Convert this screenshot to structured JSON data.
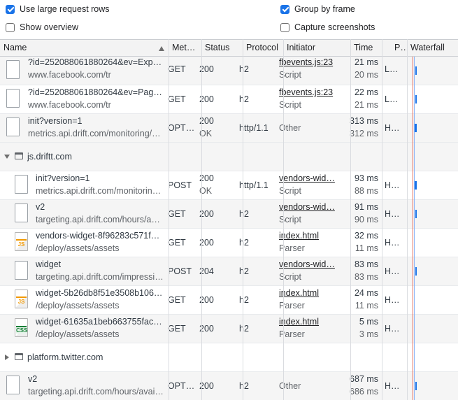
{
  "options": {
    "large_rows": {
      "label": "Use large request rows",
      "checked": true
    },
    "group_by_frame": {
      "label": "Group by frame",
      "checked": true
    },
    "show_overview": {
      "label": "Show overview",
      "checked": false
    },
    "capture_screenshots": {
      "label": "Capture screenshots",
      "checked": false
    }
  },
  "columns": {
    "name": "Name",
    "method": "Met…",
    "status": "Status",
    "protocol": "Protocol",
    "initiator": "Initiator",
    "time": "Time",
    "priority": "P…",
    "waterfall": "Waterfall"
  },
  "requests_top": [
    {
      "name": "?id=252088061880264&ev=Expe…",
      "path": "www.facebook.com/tr",
      "method": "GET",
      "status": "200",
      "status_text": "",
      "protocol": "h2",
      "initiator": "fbevents.js:23",
      "initiator_type": "Script",
      "time": "21 ms",
      "latency": "20 ms",
      "priority": "L…",
      "icon": "document-icon"
    },
    {
      "name": "?id=252088061880264&ev=Page…",
      "path": "www.facebook.com/tr",
      "method": "GET",
      "status": "200",
      "status_text": "",
      "protocol": "h2",
      "initiator": "fbevents.js:23",
      "initiator_type": "Script",
      "time": "22 ms",
      "latency": "21 ms",
      "priority": "L…",
      "icon": "document-icon"
    },
    {
      "name": "init?version=1",
      "path": "metrics.api.drift.com/monitoring/…",
      "method": "OPT…",
      "status": "200",
      "status_text": "OK",
      "protocol": "http/1.1",
      "initiator": "Other",
      "initiator_type": "",
      "time": "313 ms",
      "latency": "312 ms",
      "priority": "H…",
      "icon": "document-icon"
    }
  ],
  "group_drift": {
    "name": "js.driftt.com",
    "expanded": true
  },
  "requests_drift": [
    {
      "name": "init?version=1",
      "path": "metrics.api.drift.com/monitorin…",
      "method": "POST",
      "status": "200",
      "status_text": "OK",
      "protocol": "http/1.1",
      "initiator": "vendors-wid…",
      "initiator_type": "Script",
      "time": "93 ms",
      "latency": "88 ms",
      "priority": "H…",
      "icon": "document-icon"
    },
    {
      "name": "v2",
      "path": "targeting.api.drift.com/hours/a…",
      "method": "GET",
      "status": "200",
      "status_text": "",
      "protocol": "h2",
      "initiator": "vendors-wid…",
      "initiator_type": "Script",
      "time": "91 ms",
      "latency": "90 ms",
      "priority": "H…",
      "icon": "document-icon"
    },
    {
      "name": "vendors-widget-8f96283c571f…",
      "path": "/deploy/assets/assets",
      "method": "GET",
      "status": "200",
      "status_text": "",
      "protocol": "h2",
      "initiator": "index.html",
      "initiator_type": "Parser",
      "time": "32 ms",
      "latency": "11 ms",
      "priority": "H…",
      "icon": "js-file-icon"
    },
    {
      "name": "widget",
      "path": "targeting.api.drift.com/impressi…",
      "method": "POST",
      "status": "204",
      "status_text": "",
      "protocol": "h2",
      "initiator": "vendors-wid…",
      "initiator_type": "Script",
      "time": "83 ms",
      "latency": "83 ms",
      "priority": "H…",
      "icon": "document-icon"
    },
    {
      "name": "widget-5b26db8f51e3508b106…",
      "path": "/deploy/assets/assets",
      "method": "GET",
      "status": "200",
      "status_text": "",
      "protocol": "h2",
      "initiator": "index.html",
      "initiator_type": "Parser",
      "time": "24 ms",
      "latency": "11 ms",
      "priority": "H…",
      "icon": "js-file-icon"
    },
    {
      "name": "widget-61635a1beb663755fac…",
      "path": "/deploy/assets/assets",
      "method": "GET",
      "status": "200",
      "status_text": "",
      "protocol": "h2",
      "initiator": "index.html",
      "initiator_type": "Parser",
      "time": "5 ms",
      "latency": "3 ms",
      "priority": "H…",
      "icon": "css-file-icon"
    }
  ],
  "group_twitter": {
    "name": "platform.twitter.com",
    "expanded": false
  },
  "requests_bottom": [
    {
      "name": "v2",
      "path": "targeting.api.drift.com/hours/avai…",
      "method": "OPT…",
      "status": "200",
      "status_text": "",
      "protocol": "h2",
      "initiator": "Other",
      "initiator_type": "",
      "time": "687 ms",
      "latency": "686 ms",
      "priority": "H…",
      "icon": "document-icon"
    }
  ],
  "icon_labels": {
    "js": "JS",
    "css": "CSS"
  },
  "colors": {
    "accent": "#1a73e8",
    "header_bg": "#f3f3f3",
    "waterfall_red": "#e36a5a",
    "waterfall_blue": "#8ab4f8"
  }
}
